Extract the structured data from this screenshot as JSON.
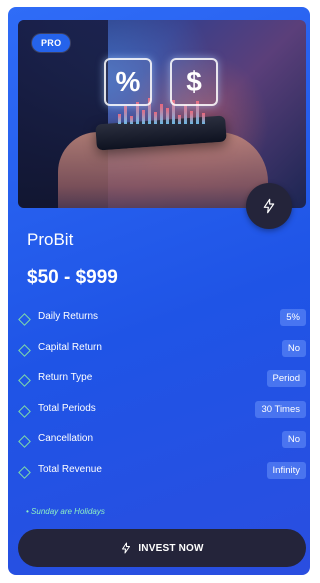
{
  "plan": {
    "badge": "PRO",
    "name": "ProBit",
    "price": "$50 - $999",
    "hero": {
      "glyph_left": "%",
      "glyph_right": "$"
    },
    "features": [
      {
        "label": "Daily Returns",
        "value": "5%"
      },
      {
        "label": "Capital Return",
        "value": "No"
      },
      {
        "label": "Return Type",
        "value": "Period"
      },
      {
        "label": "Total Periods",
        "value": "30 Times"
      },
      {
        "label": "Cancellation",
        "value": "No"
      },
      {
        "label": "Total Revenue",
        "value": "Infinity"
      }
    ],
    "note": "Sunday are Holidays",
    "invest_label": "INVEST NOW"
  },
  "icons": {
    "quick_action": "bolt-icon",
    "invest": "bolt-icon",
    "feature_bullet": "diamond-icon"
  },
  "colors": {
    "card": "#2563eb",
    "dark_button": "#24243a",
    "accent_green": "#7fdca8",
    "note_green": "#8ef0c4"
  }
}
